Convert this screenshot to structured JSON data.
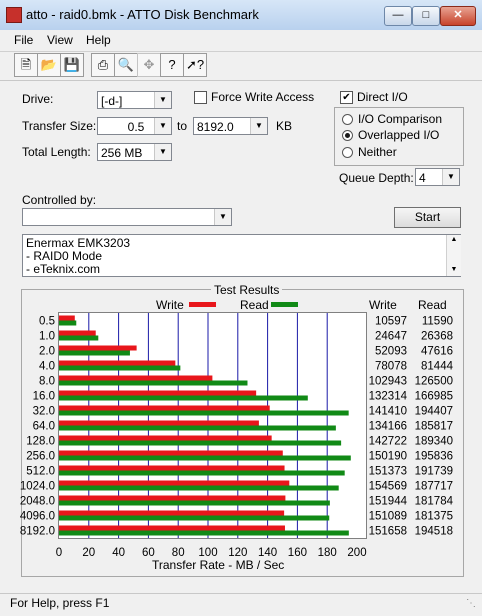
{
  "window": {
    "title": "atto - raid0.bmk - ATTO Disk Benchmark"
  },
  "menu": [
    "File",
    "View",
    "Help"
  ],
  "toolbar": {
    "new_icon": "new-file-icon",
    "open_icon": "open-folder-icon",
    "save_icon": "save-icon",
    "print_icon": "print-icon",
    "preview_icon": "print-preview-icon",
    "move_icon": "move-icon",
    "help_icon": "help-icon",
    "whats_this_icon": "context-help-icon"
  },
  "form": {
    "drive_label": "Drive:",
    "drive_value": "[-d-]",
    "force_write_label": "Force Write Access",
    "direct_io_label": "Direct I/O",
    "transfer_size_label": "Transfer Size:",
    "transfer_from": "0.5",
    "to_label": "to",
    "transfer_to": "8192.0",
    "unit_label": "KB",
    "total_length_label": "Total Length:",
    "total_length_value": "256 MB",
    "io_comparison_label": "I/O Comparison",
    "overlapped_io_label": "Overlapped I/O",
    "neither_label": "Neither",
    "queue_depth_label": "Queue Depth:",
    "queue_depth_value": "4",
    "controlled_by_label": "Controlled by:",
    "controlled_by_value": "",
    "start_label": "Start",
    "notes": [
      "Enermax EMK3203",
      "- RAID0 Mode",
      "- eTeknix.com"
    ]
  },
  "results": {
    "title": "Test Results",
    "legend_write": "Write",
    "legend_read": "Read",
    "col_write": "Write",
    "col_read": "Read",
    "xlabel": "Transfer Rate - MB / Sec",
    "write_color": "#e8161b",
    "read_color": "#118a16",
    "grid_color": "#1a1aa8"
  },
  "chart_data": {
    "type": "bar",
    "orientation": "horizontal",
    "categories": [
      "0.5",
      "1.0",
      "2.0",
      "4.0",
      "8.0",
      "16.0",
      "32.0",
      "64.0",
      "128.0",
      "256.0",
      "512.0",
      "1024.0",
      "2048.0",
      "4096.0",
      "8192.0"
    ],
    "series": [
      {
        "name": "Write",
        "values": [
          10597,
          24647,
          52093,
          78078,
          102943,
          132314,
          141410,
          134166,
          142722,
          150190,
          151373,
          154569,
          151944,
          151089,
          151658
        ]
      },
      {
        "name": "Read",
        "values": [
          11590,
          26368,
          47616,
          81444,
          126500,
          166985,
          194407,
          185817,
          189340,
          195836,
          191739,
          187717,
          181784,
          181375,
          194518
        ]
      }
    ],
    "xlabel": "Transfer Rate - MB / Sec",
    "xlim": [
      0,
      200
    ],
    "xticks": [
      "0",
      "20",
      "40",
      "60",
      "80",
      "100",
      "120",
      "140",
      "160",
      "180",
      "200"
    ],
    "unit_note": "values in KB/s"
  },
  "status": {
    "text": "For Help, press F1"
  }
}
